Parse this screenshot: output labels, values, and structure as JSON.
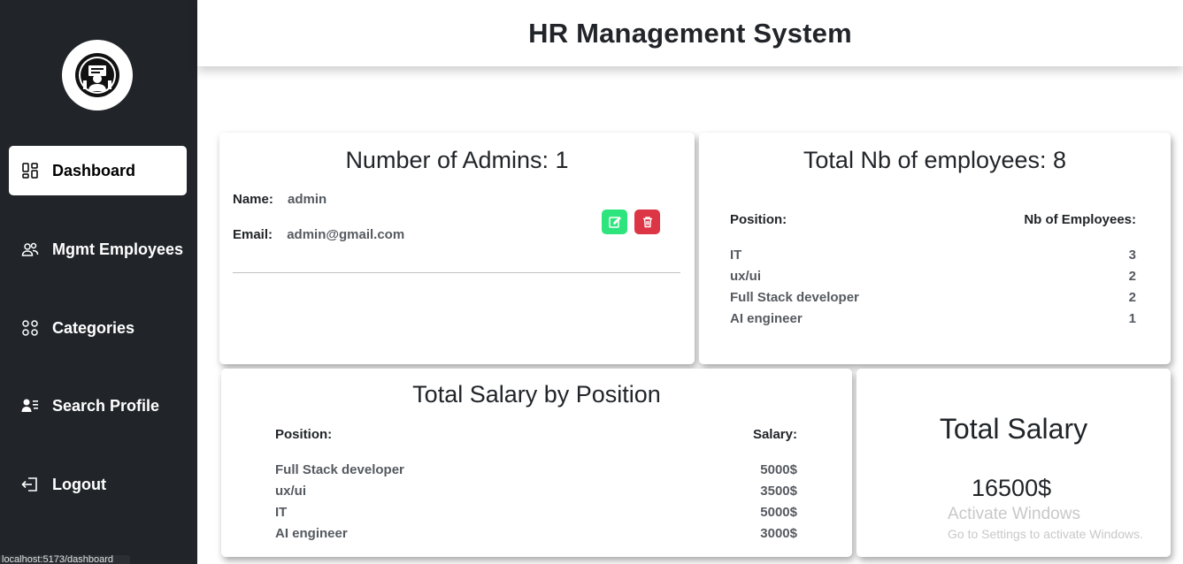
{
  "header": {
    "title": "HR Management System"
  },
  "sidebar": {
    "items": [
      {
        "label": "Dashboard",
        "icon": "grid-icon",
        "active": true
      },
      {
        "label": "Mgmt Employees",
        "icon": "people-icon"
      },
      {
        "label": "Categories",
        "icon": "circles-icon"
      },
      {
        "label": "Search Profile",
        "icon": "person-lines-icon"
      },
      {
        "label": "Logout",
        "icon": "logout-icon"
      }
    ]
  },
  "admins": {
    "title": "Number of Admins: 1",
    "name_label": "Name:",
    "name_value": "admin",
    "email_label": "Email:",
    "email_value": "admin@gmail.com"
  },
  "employees": {
    "title": "Total Nb of employees: 8",
    "col_position": "Position:",
    "col_count": "Nb of Employees:",
    "rows": [
      {
        "position": "IT",
        "count": "3"
      },
      {
        "position": "ux/ui",
        "count": "2"
      },
      {
        "position": "Full Stack developer",
        "count": "2"
      },
      {
        "position": "AI engineer",
        "count": "1"
      }
    ]
  },
  "salaries": {
    "title": "Total Salary by Position",
    "col_position": "Position:",
    "col_salary": "Salary:",
    "rows": [
      {
        "position": "Full Stack developer",
        "salary": "5000$"
      },
      {
        "position": "ux/ui",
        "salary": "3500$"
      },
      {
        "position": "IT",
        "salary": "5000$"
      },
      {
        "position": "AI engineer",
        "salary": "3000$"
      }
    ]
  },
  "total": {
    "title": "Total Salary",
    "value": "16500$"
  },
  "watermark": {
    "line1": "Activate Windows",
    "line2": "Go to Settings to activate Windows."
  },
  "statusbar": {
    "url": "localhost:5173/dashboard"
  },
  "colors": {
    "sidebar": "#212529",
    "edit": "#2ee57d",
    "delete": "#dc3545"
  }
}
